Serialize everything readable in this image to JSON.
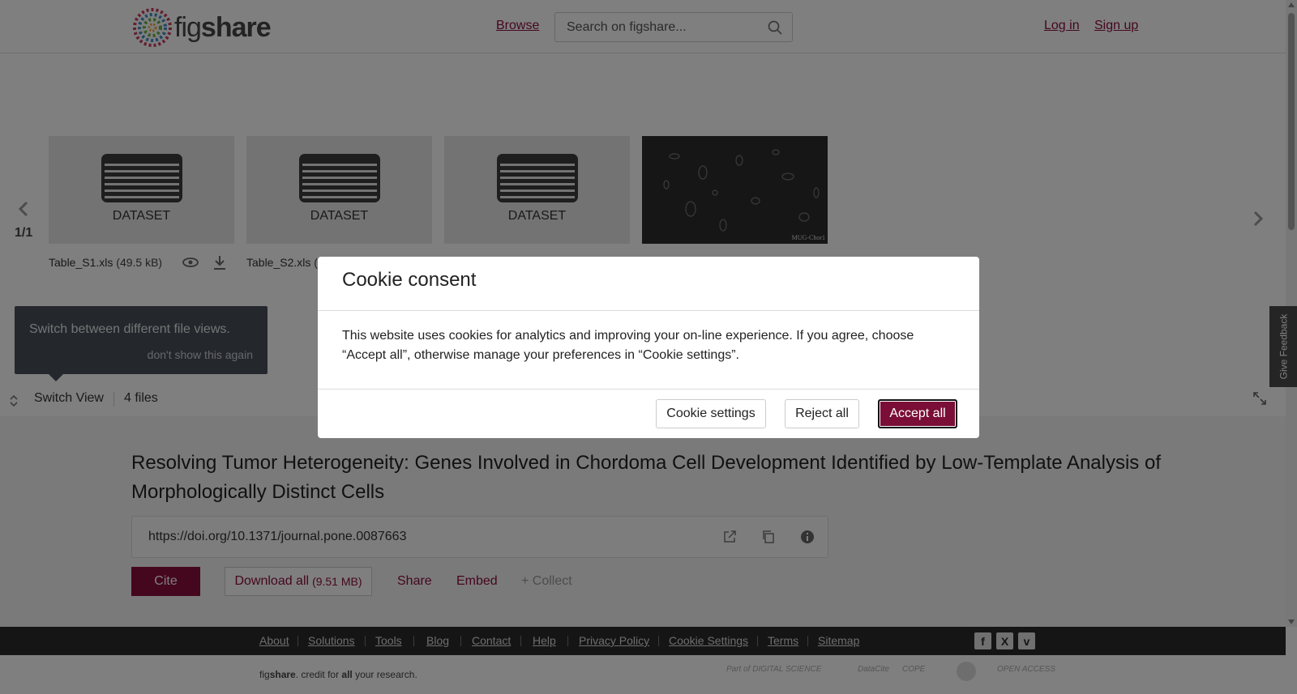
{
  "header": {
    "logo_text_light": "fig",
    "logo_text_bold": "share",
    "browse": "Browse",
    "search_placeholder": "Search on figshare...",
    "login": "Log in",
    "signup": "Sign up"
  },
  "carousel": {
    "pager": "1/1",
    "cards": [
      {
        "type": "DATASET",
        "filename": "Table_S1.xls",
        "size": "(49.5 kB)"
      },
      {
        "type": "DATASET",
        "filename": "Table_S2.xls",
        "size": "("
      },
      {
        "type": "DATASET"
      },
      {
        "type": "image",
        "caption": "MUG-Chor1"
      }
    ]
  },
  "tooltip": {
    "text": "Switch between different file views.",
    "dismiss": "don't show this again"
  },
  "file_bar": {
    "switch_view": "Switch View",
    "file_count": "4 files"
  },
  "article": {
    "title": "Resolving Tumor Heterogeneity: Genes Involved in Chordoma Cell Development Identified by Low-Template Analysis of Morphologically Distinct Cells",
    "doi": "https://doi.org/10.1371/journal.pone.0087663",
    "cite": "Cite",
    "download_all": "Download all",
    "download_size": "(9.51 MB)",
    "share": "Share",
    "embed": "Embed",
    "collect": "+ Collect"
  },
  "feedback": "Give Feedback",
  "footer": {
    "links": [
      "About",
      "Solutions",
      "Tools",
      "Blog",
      "Contact",
      "Help",
      "Privacy Policy",
      "Cookie Settings",
      "Terms",
      "Sitemap"
    ],
    "social": [
      "f",
      "X",
      "v"
    ],
    "credit_pre": "fig",
    "credit_bold": "share",
    "credit_mid": ". credit for ",
    "credit_all": "all",
    "credit_end": " your research.",
    "partners": [
      "Part of DIGITAL SCIENCE",
      "DataCite",
      "COPE",
      "seal",
      "OPEN ACCESS"
    ]
  },
  "cookie_modal": {
    "title": "Cookie consent",
    "body": "This website uses cookies for analytics and improving your on-line experience. If you agree, choose “Accept all”, otherwise manage your preferences in “Cookie settings”.",
    "settings": "Cookie settings",
    "reject": "Reject all",
    "accept": "Accept all"
  },
  "colors": {
    "brand": "#8b0f3d",
    "accept_button": "#7a0e36",
    "footer_bg": "#2a2a2a"
  }
}
